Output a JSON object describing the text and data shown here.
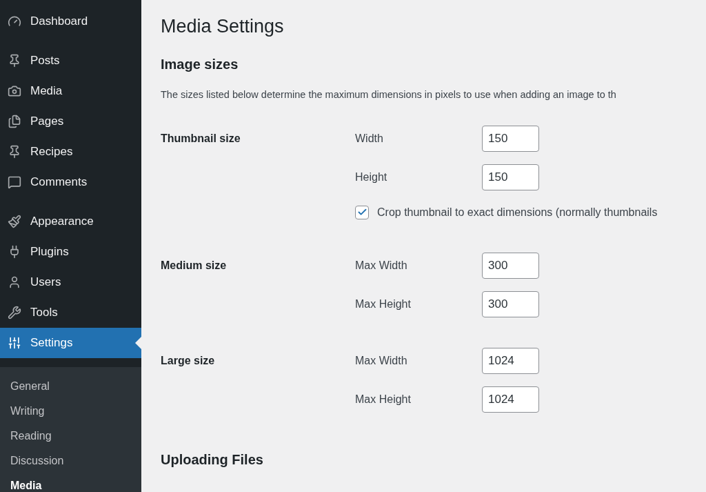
{
  "sidebar": {
    "groups": [
      {
        "items": [
          {
            "label": "Dashboard",
            "kind": "dashboard",
            "selected": false
          }
        ]
      },
      {
        "items": [
          {
            "label": "Posts",
            "kind": "pin",
            "selected": false
          },
          {
            "label": "Media",
            "kind": "media",
            "selected": false
          },
          {
            "label": "Pages",
            "kind": "pages",
            "selected": false
          },
          {
            "label": "Recipes",
            "kind": "pin",
            "selected": false
          },
          {
            "label": "Comments",
            "kind": "comment",
            "selected": false
          }
        ]
      },
      {
        "items": [
          {
            "label": "Appearance",
            "kind": "brush",
            "selected": false
          },
          {
            "label": "Plugins",
            "kind": "plug",
            "selected": false
          },
          {
            "label": "Users",
            "kind": "user",
            "selected": false
          },
          {
            "label": "Tools",
            "kind": "wrench",
            "selected": false
          },
          {
            "label": "Settings",
            "kind": "sliders",
            "selected": true
          }
        ]
      }
    ],
    "submenu": [
      {
        "label": "General",
        "selected": false
      },
      {
        "label": "Writing",
        "selected": false
      },
      {
        "label": "Reading",
        "selected": false
      },
      {
        "label": "Discussion",
        "selected": false
      },
      {
        "label": "Media",
        "selected": true
      }
    ]
  },
  "page": {
    "title": "Media Settings",
    "section_title": "Image sizes",
    "description": "The sizes listed below determine the maximum dimensions in pixels to use when adding an image to th",
    "sizes": [
      {
        "label": "Thumbnail size",
        "fields": [
          {
            "label": "Width",
            "value": "150"
          },
          {
            "label": "Height",
            "value": "150"
          }
        ],
        "options": [
          {
            "label": "Crop thumbnail to exact dimensions (normally thumbnails",
            "checked": true
          }
        ]
      },
      {
        "label": "Medium size",
        "fields": [
          {
            "label": "Max Width",
            "value": "300"
          },
          {
            "label": "Max Height",
            "value": "300"
          }
        ]
      },
      {
        "label": "Large size",
        "fields": [
          {
            "label": "Max Width",
            "value": "1024"
          },
          {
            "label": "Max Height",
            "value": "1024"
          }
        ]
      }
    ],
    "next_section_title": "Uploading Files"
  }
}
